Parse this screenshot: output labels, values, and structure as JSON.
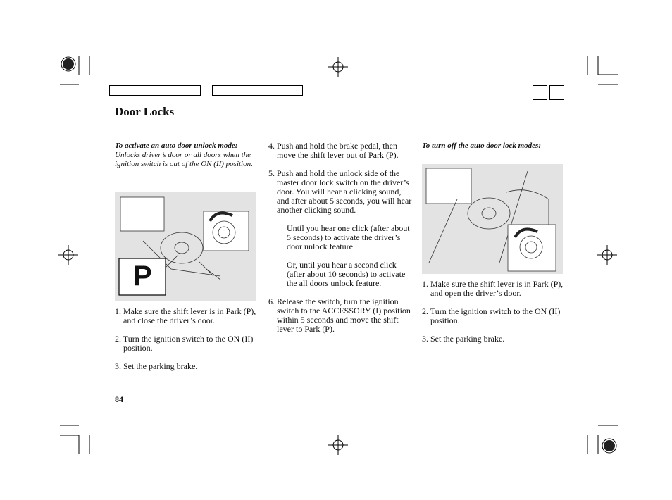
{
  "header": {
    "title": "Door Locks",
    "page_number": "84"
  },
  "left_column": {
    "heading": "To activate an auto door unlock mode:",
    "description": "Unlocks driver’s door or all doors when the ignition switch is out of the ON (II) position.",
    "figure_label": "P",
    "steps": [
      "1. Make sure the shift lever is in Park (P), and close the driver’s door.",
      "2. Turn the ignition switch to the ON (II) position.",
      "3. Set the parking brake."
    ]
  },
  "middle_column": {
    "steps": [
      "4. Push and hold the brake pedal, then move the shift lever out of Park (P).",
      "5. Push and hold the unlock side of the master door lock switch on the driver’s door. You will hear a clicking sound, and after about 5 seconds, you will hear another clicking sound."
    ],
    "notes": [
      "Until you hear one click (after about 5 seconds) to activate the driver’s door unlock feature.",
      "Or, until you hear a second click (after about 10 seconds) to activate the all doors unlock feature."
    ],
    "final_step": "6. Release the switch, turn the ignition switch to the ACCESSORY (I) position within 5 seconds and move the shift lever to Park (P)."
  },
  "right_column": {
    "heading": "To turn off the auto door lock modes:",
    "steps": [
      "1. Make sure the shift lever is in Park (P), and open the driver’s door.",
      "2. Turn the ignition switch to the ON (II) position.",
      "3. Set the parking brake."
    ]
  },
  "colors": {
    "figure_bg": "#e3e3e3",
    "text": "#111111"
  }
}
